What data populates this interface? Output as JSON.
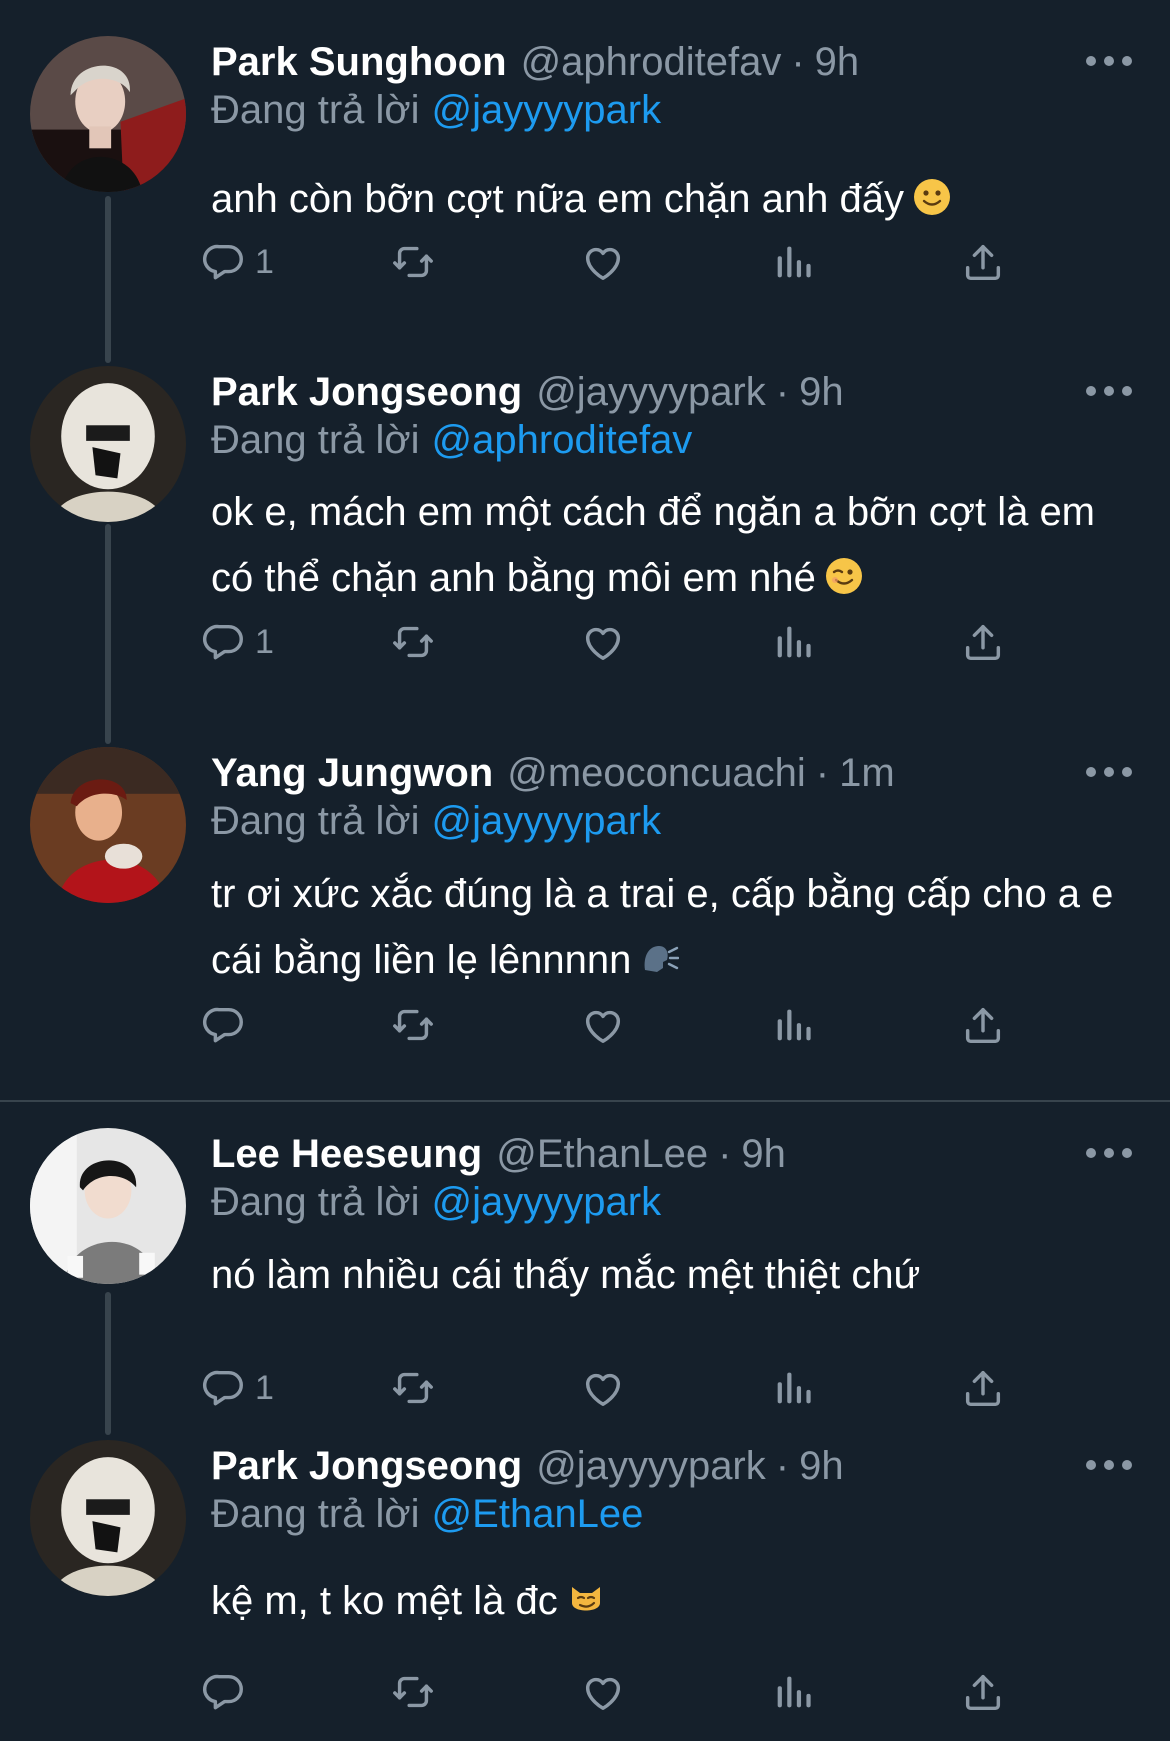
{
  "tweets": [
    {
      "name": "Park Sunghoon",
      "handle": "@aphroditefav",
      "dot": "·",
      "time": "9h",
      "reply_prefix": "Đang trả lời",
      "reply_to": "@jayyyypark",
      "text": "anh còn bỡn cợt nữa em chặn anh đấy",
      "emoji": "slightly-smiling-face",
      "reply_count": "1",
      "avatar": "sunghoon-avatar"
    },
    {
      "name": "Park Jongseong",
      "handle": "@jayyyypark",
      "dot": "·",
      "time": "9h",
      "reply_prefix": "Đang trả lời",
      "reply_to": "@aphroditefav",
      "text": "ok e, mách em một cách để ngăn a bỡn cợt là em có thể chặn anh bằng môi em nhé",
      "emoji": "winking-face",
      "reply_count": "1",
      "avatar": "jongseong-avatar"
    },
    {
      "name": "Yang Jungwon",
      "handle": "@meoconcuachi",
      "dot": "·",
      "time": "1m",
      "reply_prefix": "Đang trả lời",
      "reply_to": "@jayyyypark",
      "text": "tr ơi xức xắc đúng là a trai e, cấp bằng cấp cho a e cái bằng liền lẹ lênnnnn",
      "emoji": "speaking-head",
      "reply_count": "",
      "avatar": "jungwon-avatar"
    },
    {
      "name": "Lee Heeseung",
      "handle": "@EthanLee",
      "dot": "·",
      "time": "9h",
      "reply_prefix": "Đang trả lời",
      "reply_to": "@jayyyypark",
      "text": "nó làm nhiều cái thấy mắc mệt thiệt chứ",
      "emoji": "",
      "reply_count": "1",
      "avatar": "heeseung-avatar"
    },
    {
      "name": "Park Jongseong",
      "handle": "@jayyyypark",
      "dot": "·",
      "time": "9h",
      "reply_prefix": "Đang trả lời",
      "reply_to": "@EthanLee",
      "text": "kệ m, t ko mệt là đc",
      "emoji": "smirking-cat",
      "reply_count": "",
      "avatar": "jongseong-avatar"
    }
  ],
  "icons": {
    "reply": "reply-icon",
    "retweet": "retweet-icon",
    "like": "like-icon",
    "views": "views-icon",
    "share": "share-icon",
    "more": "more-icon"
  },
  "colors": {
    "background": "#15202b",
    "secondary_text": "#8b98a5",
    "link": "#1d9bf0",
    "divider": "#38444d"
  }
}
